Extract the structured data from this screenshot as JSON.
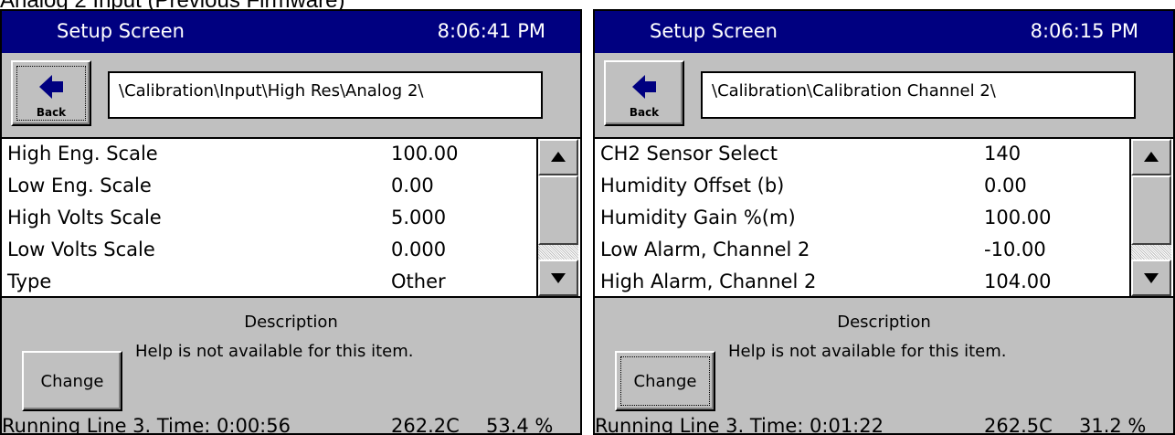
{
  "caption": "Analog 2 Input (Previous Firmware)",
  "colors": {
    "titlebar": "#000080",
    "window": "#c0c0c0",
    "list_bg": "#ffffff"
  },
  "icons": {
    "back": "back-arrow-icon",
    "scroll_up": "scroll-up-arrow-icon",
    "scroll_down": "scroll-down-arrow-icon"
  },
  "left": {
    "title": "Setup Screen",
    "time": "8:06:41 PM",
    "back_label": "Back",
    "path": "\\Calibration\\Input\\High Res\\Analog 2\\",
    "rows": [
      {
        "name": "High Eng. Scale",
        "value": "100.00"
      },
      {
        "name": "Low Eng. Scale",
        "value": "0.00"
      },
      {
        "name": "High Volts Scale",
        "value": "5.000"
      },
      {
        "name": "Low Volts Scale",
        "value": "0.000"
      },
      {
        "name": "Type",
        "value": "Other"
      }
    ],
    "description_title": "Description",
    "help_text": "Help is not available for this item.",
    "change_label": "Change",
    "status": {
      "line": "Running Line 3.  Time: 0:00:56",
      "temp": "262.2C",
      "percent": "53.4 %"
    }
  },
  "right": {
    "title": "Setup Screen",
    "time": "8:06:15 PM",
    "back_label": "Back",
    "path": "\\Calibration\\Calibration Channel 2\\",
    "rows": [
      {
        "name": "CH2 Sensor Select",
        "value": "140"
      },
      {
        "name": "Humidity Offset (b)",
        "value": "0.00"
      },
      {
        "name": "Humidity Gain %(m)",
        "value": "100.00"
      },
      {
        "name": "Low Alarm, Channel 2",
        "value": "-10.00"
      },
      {
        "name": "High Alarm, Channel 2",
        "value": "104.00"
      }
    ],
    "description_title": "Description",
    "help_text": "Help is not available for this item.",
    "change_label": "Change",
    "status": {
      "line": "Running Line 3.  Time: 0:01:22",
      "temp": "262.5C",
      "percent": "31.2 %"
    }
  }
}
